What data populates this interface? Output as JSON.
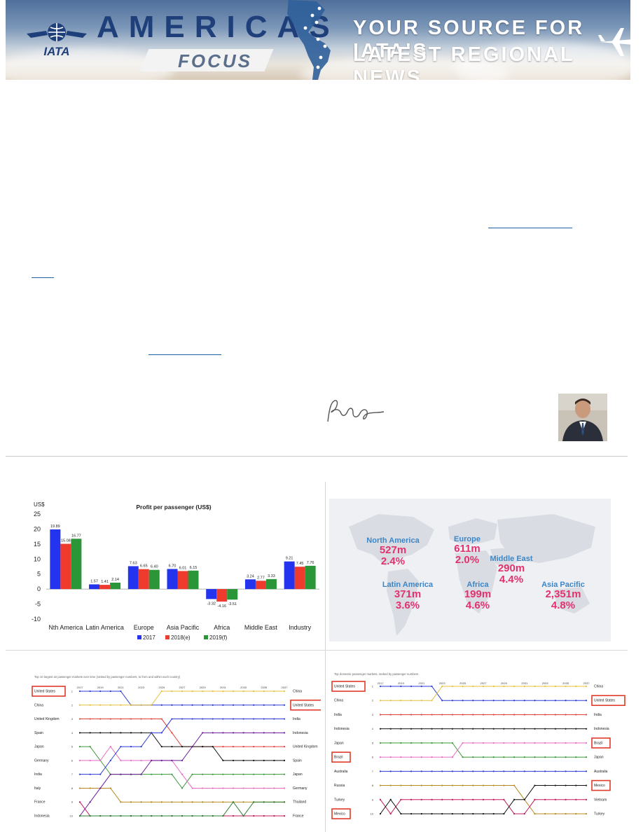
{
  "banner": {
    "org": "IATA",
    "title": "AMERICAS",
    "subtitle": "FOCUS",
    "tagline_1": "YOUR SOURCE FOR IATA'S",
    "tagline_2": "LATEST REGIONAL NEWS"
  },
  "colors": {
    "brand": "#1f3f7a",
    "s2017": "#2433ee",
    "s2018": "#ee3b2e",
    "s2019": "#2a9637",
    "pink": "#e2326e",
    "blue_label": "#3d86c6"
  },
  "chart_data": [
    {
      "type": "bar",
      "title": "Profit per passenger (US$)",
      "ylabel": "US$",
      "ylim": [
        -10,
        25
      ],
      "yticks": [
        25,
        20,
        15,
        10,
        5,
        0,
        -5,
        -10
      ],
      "grid": false,
      "legend": "bottom",
      "categories": [
        "Nth America",
        "Latin America",
        "Europe",
        "Asia Pacific",
        "Africa",
        "Middle East",
        "Industry"
      ],
      "series": [
        {
          "name": "2017",
          "color": "#2433ee",
          "values": [
            19.89,
            1.57,
            7.63,
            6.7,
            -3.32,
            3.24,
            9.21
          ],
          "labels": [
            "19.89",
            "1.57",
            "7.63",
            "6.70",
            "-3.32",
            "3.24",
            "9.21"
          ]
        },
        {
          "name": "2018(e)",
          "color": "#ee3b2e",
          "values": [
            15.08,
            1.41,
            6.65,
            6.01,
            -4.16,
            2.77,
            7.45
          ],
          "labels": [
            "15.08",
            "1.41",
            "6.65",
            "6.01",
            "-4.16",
            "2.77",
            "7.45"
          ]
        },
        {
          "name": "2019(f)",
          "color": "#2a9637",
          "values": [
            16.77,
            2.14,
            6.4,
            6.15,
            -3.51,
            3.33,
            7.76
          ],
          "labels": [
            "16.77",
            "2.14",
            "6.40",
            "6.15",
            "-3.51",
            "3.33",
            "7.76"
          ]
        }
      ]
    },
    {
      "type": "table",
      "regions": [
        {
          "name": "North America",
          "passengers": "527m",
          "growth": "2.4%"
        },
        {
          "name": "Europe",
          "passengers": "611m",
          "growth": "2.0%"
        },
        {
          "name": "Middle East",
          "passengers": "290m",
          "growth": "4.4%"
        },
        {
          "name": "Latin America",
          "passengers": "371m",
          "growth": "3.6%"
        },
        {
          "name": "Africa",
          "passengers": "199m",
          "growth": "4.6%"
        },
        {
          "name": "Asia Pacific",
          "passengers": "2,351m",
          "growth": "4.8%"
        }
      ]
    },
    {
      "type": "line",
      "title": "Top 10 largest air passenger markets over time (ranked by passenger numbers, to from and within each country)",
      "x": [
        "2017",
        "2019",
        "2021",
        "2023",
        "2025",
        "2027",
        "2029",
        "2031",
        "2033",
        "2035",
        "2037"
      ],
      "ranks": [
        "1",
        "2",
        "3",
        "4",
        "5",
        "6",
        "7",
        "8",
        "9",
        "10"
      ],
      "start_labels": [
        "United States",
        "China",
        "United Kingdom",
        "Spain",
        "Japan",
        "Germany",
        "India",
        "Italy",
        "France",
        "Indonesia"
      ],
      "end_labels": [
        "China",
        "United States",
        "India",
        "Indonesia",
        "United Kingdom",
        "Spain",
        "Japan",
        "Germany",
        "Thailand",
        "France"
      ],
      "highlighted": [
        "United States"
      ],
      "series": [
        {
          "name": "United States",
          "color": "#2b3bd6",
          "ranks": [
            1,
            1,
            1,
            1,
            1,
            2,
            2,
            2,
            2,
            2,
            2,
            2,
            2,
            2,
            2,
            2,
            2,
            2,
            2,
            2,
            2
          ]
        },
        {
          "name": "China",
          "color": "#e6c13a",
          "ranks": [
            2,
            2,
            2,
            2,
            2,
            2,
            2,
            2,
            1,
            1,
            1,
            1,
            1,
            1,
            1,
            1,
            1,
            1,
            1,
            1,
            1
          ]
        },
        {
          "name": "United Kingdom",
          "color": "#e0413b",
          "ranks": [
            3,
            3,
            3,
            3,
            3,
            3,
            3,
            3,
            3,
            4,
            5,
            5,
            5,
            5,
            5,
            5,
            5,
            5,
            5,
            5,
            5
          ]
        },
        {
          "name": "Spain",
          "color": "#111111",
          "ranks": [
            4,
            4,
            4,
            4,
            4,
            4,
            4,
            4,
            5,
            5,
            5,
            5,
            5,
            5,
            6,
            6,
            6,
            6,
            6,
            6,
            6
          ]
        },
        {
          "name": "Japan",
          "color": "#3a9a3a",
          "ranks": [
            5,
            5,
            6,
            7,
            7,
            7,
            7,
            7,
            7,
            7,
            8,
            7,
            7,
            7,
            7,
            7,
            7,
            7,
            7,
            7,
            7
          ]
        },
        {
          "name": "Germany",
          "color": "#e86cc4",
          "ranks": [
            6,
            6,
            6,
            5,
            6,
            6,
            6,
            6,
            6,
            6,
            7,
            8,
            8,
            8,
            8,
            8,
            8,
            8,
            8,
            8,
            8
          ]
        },
        {
          "name": "India",
          "color": "#2b3bd6",
          "ranks": [
            7,
            7,
            7,
            6,
            5,
            5,
            5,
            4,
            4,
            3,
            3,
            3,
            3,
            3,
            3,
            3,
            3,
            3,
            3,
            3,
            3
          ]
        },
        {
          "name": "Italy",
          "color": "#b58b1e",
          "ranks": [
            8,
            8,
            8,
            8,
            9,
            9,
            9,
            9,
            9,
            9,
            9,
            9,
            9,
            9,
            9,
            9,
            9,
            9,
            9,
            9,
            9
          ]
        },
        {
          "name": "France",
          "color": "#c2185b",
          "ranks": [
            9,
            10,
            10,
            10,
            10,
            10,
            10,
            10,
            10,
            10,
            10,
            10,
            10,
            10,
            10,
            10,
            10,
            10,
            10,
            10,
            10
          ]
        },
        {
          "name": "Indonesia",
          "color": "#6a1b9a",
          "ranks": [
            10,
            9,
            8,
            7,
            7,
            7,
            7,
            6,
            6,
            6,
            6,
            5,
            4,
            4,
            4,
            4,
            4,
            4,
            4,
            4,
            4
          ]
        },
        {
          "name": "Thailand",
          "color": "#2e7d32",
          "ranks": [
            10,
            10,
            10,
            10,
            10,
            10,
            10,
            10,
            10,
            10,
            10,
            10,
            10,
            10,
            10,
            9,
            10,
            9,
            9,
            9,
            9
          ]
        }
      ]
    },
    {
      "type": "line",
      "title": "Top domestic passenger markets, ranked by passenger numbers",
      "x": [
        "2017",
        "2019",
        "2021",
        "2023",
        "2025",
        "2027",
        "2029",
        "2031",
        "2033",
        "2035",
        "2037"
      ],
      "ranks": [
        "1",
        "2",
        "3",
        "4",
        "5",
        "6",
        "7",
        "8",
        "9",
        "10"
      ],
      "start_labels": [
        "United States",
        "China",
        "India",
        "Indonesia",
        "Japan",
        "Brazil",
        "Australia",
        "Russia",
        "Turkey",
        "Mexico"
      ],
      "end_labels": [
        "China",
        "United States",
        "India",
        "Indonesia",
        "Brazil",
        "Japan",
        "Australia",
        "Mexico",
        "Vietnam",
        "Turkey"
      ],
      "highlighted": [
        "United States",
        "Brazil",
        "Mexico"
      ],
      "series": [
        {
          "name": "United States",
          "color": "#2b3bd6",
          "ranks": [
            1,
            1,
            1,
            1,
            1,
            1,
            2,
            2,
            2,
            2,
            2,
            2,
            2,
            2,
            2,
            2,
            2,
            2,
            2,
            2,
            2
          ]
        },
        {
          "name": "China",
          "color": "#e6c13a",
          "ranks": [
            2,
            2,
            2,
            2,
            2,
            2,
            1,
            1,
            1,
            1,
            1,
            1,
            1,
            1,
            1,
            1,
            1,
            1,
            1,
            1,
            1
          ]
        },
        {
          "name": "India",
          "color": "#e0413b",
          "ranks": [
            3,
            3,
            3,
            3,
            3,
            3,
            3,
            3,
            3,
            3,
            3,
            3,
            3,
            3,
            3,
            3,
            3,
            3,
            3,
            3,
            3
          ]
        },
        {
          "name": "Indonesia",
          "color": "#111111",
          "ranks": [
            4,
            4,
            4,
            4,
            4,
            4,
            4,
            4,
            4,
            4,
            4,
            4,
            4,
            4,
            4,
            4,
            4,
            4,
            4,
            4,
            4
          ]
        },
        {
          "name": "Japan",
          "color": "#3a9a3a",
          "ranks": [
            5,
            5,
            5,
            5,
            5,
            5,
            5,
            5,
            6,
            6,
            6,
            6,
            6,
            6,
            6,
            6,
            6,
            6,
            6,
            6,
            6
          ]
        },
        {
          "name": "Brazil",
          "color": "#e86cc4",
          "ranks": [
            6,
            6,
            6,
            6,
            6,
            6,
            6,
            6,
            5,
            5,
            5,
            5,
            5,
            5,
            5,
            5,
            5,
            5,
            5,
            5,
            5
          ]
        },
        {
          "name": "Australia",
          "color": "#2b3bd6",
          "ranks": [
            7,
            7,
            7,
            7,
            7,
            7,
            7,
            7,
            7,
            7,
            7,
            7,
            7,
            7,
            7,
            7,
            7,
            7,
            7,
            7,
            7
          ]
        },
        {
          "name": "Russia",
          "color": "#b58b1e",
          "ranks": [
            8,
            8,
            8,
            8,
            8,
            8,
            8,
            8,
            8,
            8,
            8,
            8,
            8,
            8,
            9,
            10,
            10,
            10,
            10,
            10,
            10
          ]
        },
        {
          "name": "Turkey",
          "color": "#c2185b",
          "ranks": [
            9,
            10,
            9,
            9,
            9,
            9,
            9,
            9,
            9,
            9,
            9,
            9,
            9,
            10,
            10,
            9,
            9,
            9,
            9,
            9,
            9
          ]
        },
        {
          "name": "Mexico",
          "color": "#111111",
          "ranks": [
            10,
            9,
            10,
            10,
            10,
            10,
            10,
            10,
            10,
            10,
            10,
            10,
            10,
            9,
            9,
            8,
            8,
            8,
            8,
            8,
            8
          ]
        }
      ]
    }
  ]
}
